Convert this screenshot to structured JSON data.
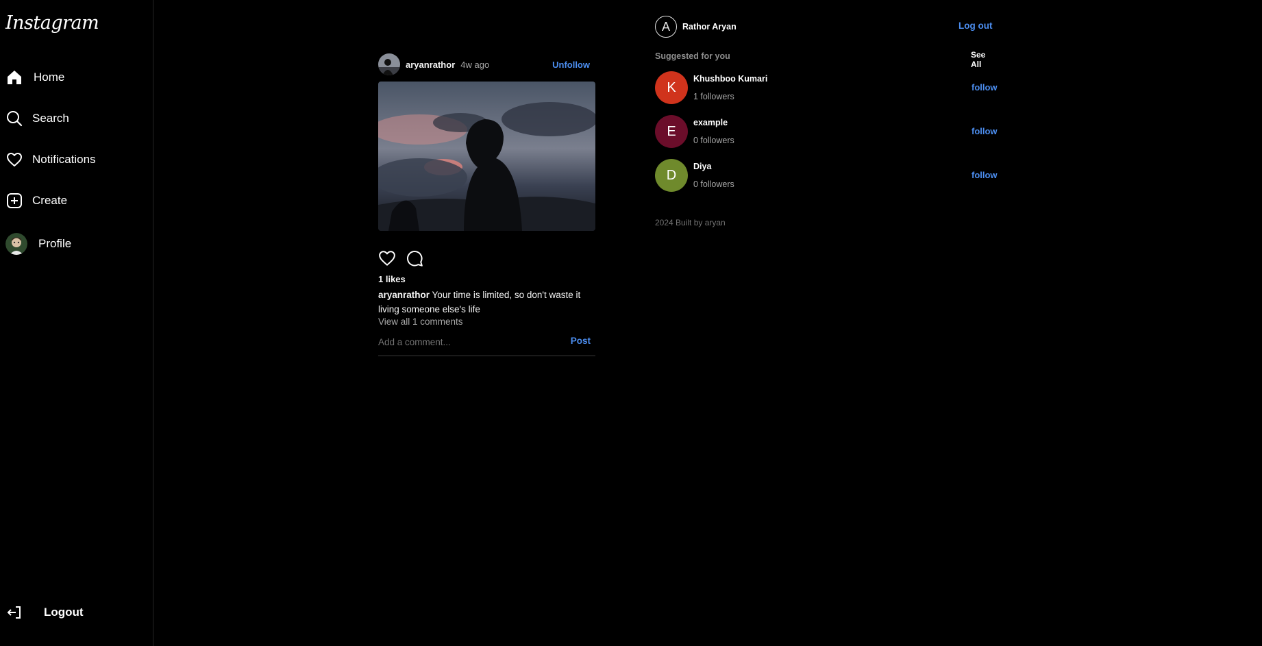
{
  "sidebar": {
    "logo": "Instagram",
    "items": [
      {
        "label": "Home",
        "icon": "home-icon"
      },
      {
        "label": "Search",
        "icon": "search-icon"
      },
      {
        "label": "Notifications",
        "icon": "heart-icon"
      },
      {
        "label": "Create",
        "icon": "plus-square-icon"
      },
      {
        "label": "Profile",
        "icon": "profile-avatar"
      }
    ],
    "logout_label": "Logout"
  },
  "post": {
    "username": "aryanrathor",
    "time": "4w ago",
    "unfollow_label": "Unfollow",
    "likes": "1 likes",
    "caption_user": "aryanrathor",
    "caption_text": "Your time is limited, so don't waste it living someone else's life",
    "view_comments": "View all 1 comments",
    "comment_placeholder": "Add a comment...",
    "post_label": "Post"
  },
  "right": {
    "me_initial": "A",
    "me_name": "Rathor Aryan",
    "logout_label": "Log out",
    "suggested_title": "Suggested for you",
    "see_all_label": "See All",
    "suggestions": [
      {
        "initial": "K",
        "name": "Khushboo Kumari",
        "followers": "1 followers",
        "follow_label": "follow",
        "color": "#d0331c"
      },
      {
        "initial": "E",
        "name": "example",
        "followers": "0 followers",
        "follow_label": "follow",
        "color": "#6b0d2a"
      },
      {
        "initial": "D",
        "name": "Diya",
        "followers": "0 followers",
        "follow_label": "follow",
        "color": "#6f8a2c"
      }
    ],
    "footer": "2024 Built by aryan"
  },
  "colors": {
    "background": "#000000",
    "accent": "#4c8ef0",
    "muted": "#a8a8a8"
  }
}
